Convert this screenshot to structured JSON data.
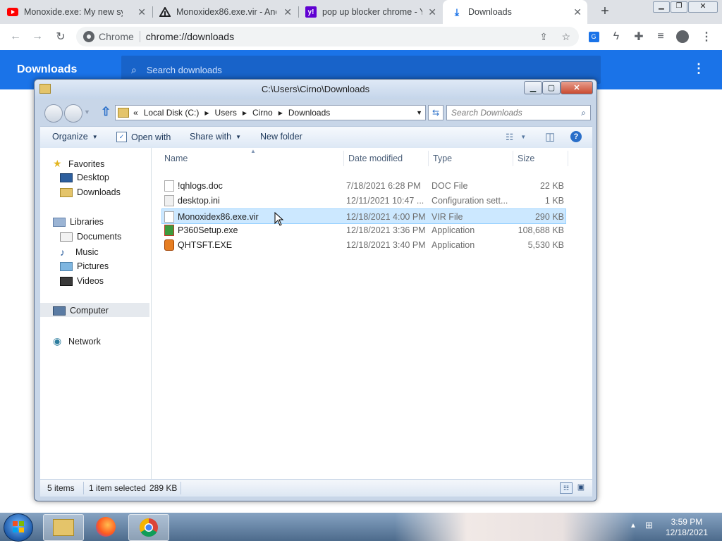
{
  "browser": {
    "tabs": [
      {
        "title": "Monoxide.exe: My new sys",
        "favicon": "youtube-icon",
        "active": false
      },
      {
        "title": "Monoxidex86.exe.vir - Ano",
        "favicon": "anonfiles-icon",
        "active": false
      },
      {
        "title": "pop up blocker chrome - Y",
        "favicon": "yahoo-icon",
        "active": false
      },
      {
        "title": "Downloads",
        "favicon": "download-icon",
        "active": true
      }
    ],
    "omnibox": {
      "site_label": "Chrome",
      "url": "chrome://downloads"
    }
  },
  "downloads_page": {
    "title": "Downloads",
    "search_placeholder": "Search downloads"
  },
  "explorer": {
    "title": "C:\\Users\\Cirno\\Downloads",
    "breadcrumb": {
      "overflow": "«",
      "parts": [
        "Local Disk (C:)",
        "Users",
        "Cirno",
        "Downloads"
      ]
    },
    "search_placeholder": "Search Downloads",
    "commands": {
      "organize": "Organize",
      "open_with": "Open with",
      "share_with": "Share with",
      "new_folder": "New folder"
    },
    "nav": {
      "favorites": "Favorites",
      "favorites_items": [
        "Desktop",
        "Downloads"
      ],
      "libraries": "Libraries",
      "libraries_items": [
        "Documents",
        "Music",
        "Pictures",
        "Videos"
      ],
      "computer": "Computer",
      "network": "Network"
    },
    "columns": {
      "name": "Name",
      "date": "Date modified",
      "type": "Type",
      "size": "Size"
    },
    "files": [
      {
        "name": "!qhlogs.doc",
        "date": "7/18/2021 6:28 PM",
        "type": "DOC File",
        "size": "22 KB"
      },
      {
        "name": "desktop.ini",
        "date": "12/11/2021 10:47 ...",
        "type": "Configuration sett...",
        "size": "1 KB"
      },
      {
        "name": "Monoxidex86.exe.vir",
        "date": "12/18/2021 4:00 PM",
        "type": "VIR File",
        "size": "290 KB"
      },
      {
        "name": "P360Setup.exe",
        "date": "12/18/2021 3:36 PM",
        "type": "Application",
        "size": "108,688 KB"
      },
      {
        "name": "QHTSFT.EXE",
        "date": "12/18/2021 3:40 PM",
        "type": "Application",
        "size": "5,530 KB"
      }
    ],
    "status": {
      "count": "5 items",
      "selected": "1 item selected",
      "selected_size": "289 KB"
    }
  },
  "taskbar": {
    "time": "3:59 PM",
    "date": "12/18/2021"
  },
  "colors": {
    "chrome_blue": "#1a73e8",
    "selection": "#cce8ff",
    "tab_strip": "#dee1e6"
  }
}
